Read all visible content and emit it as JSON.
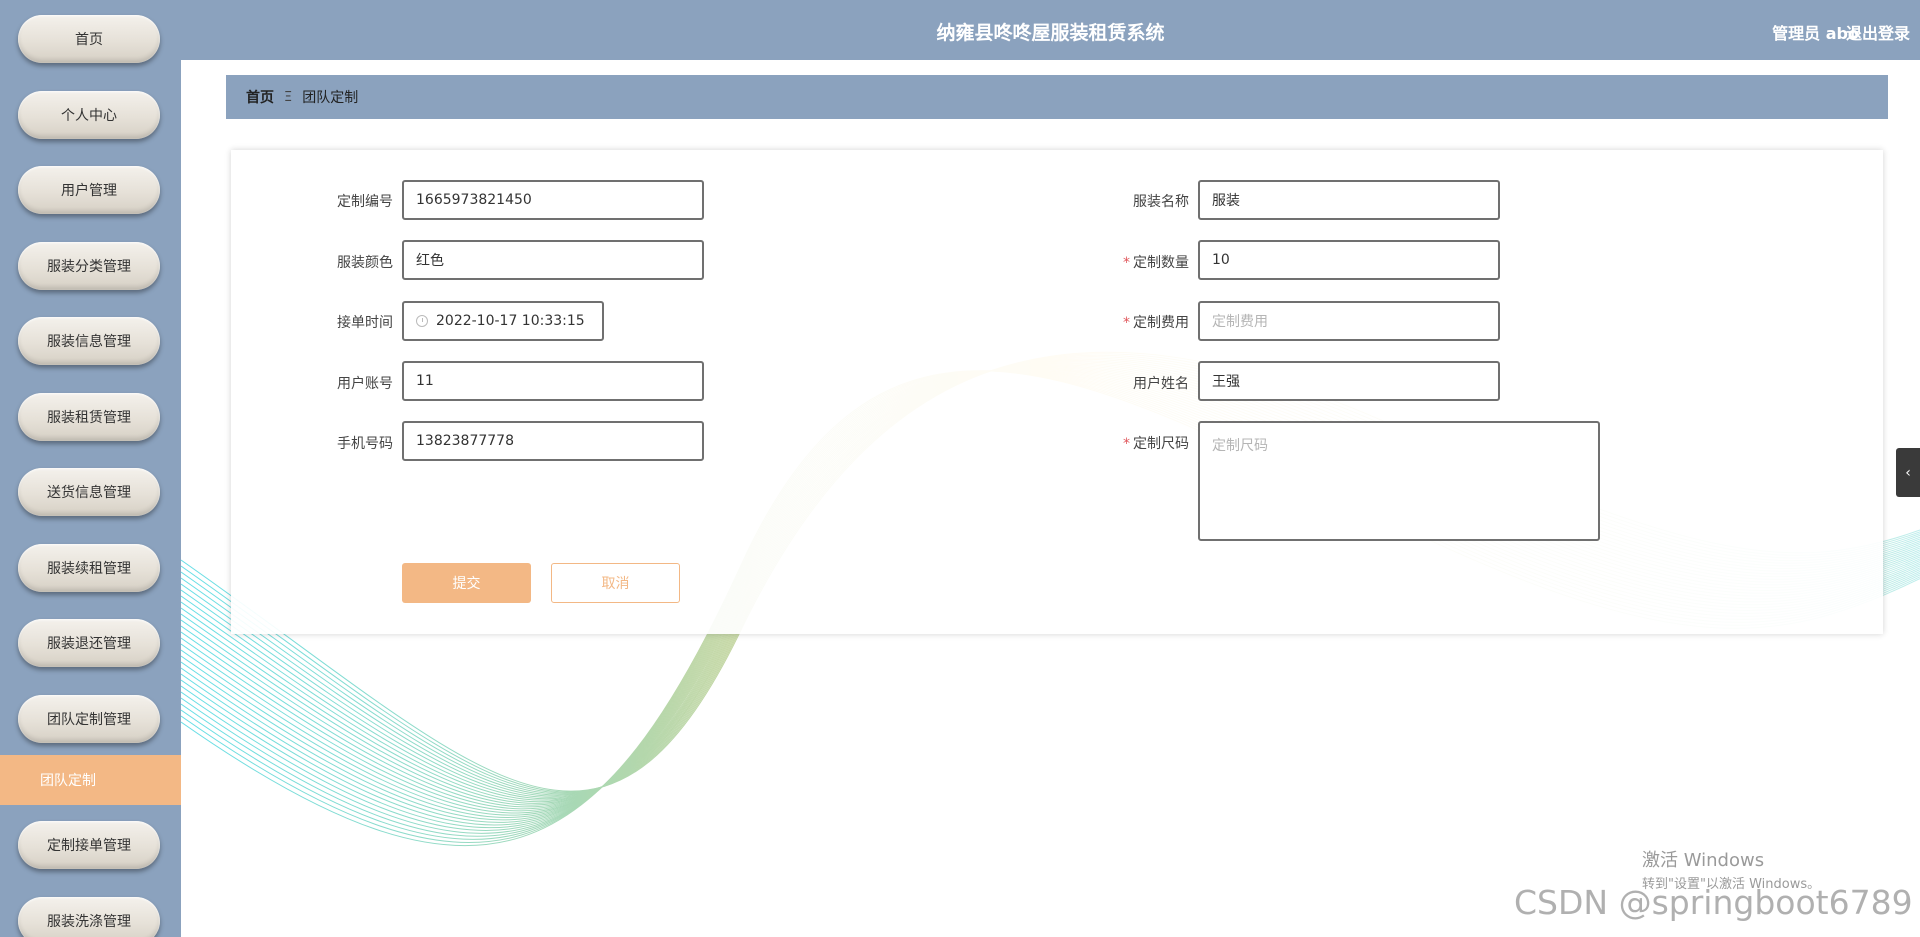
{
  "header": {
    "title": "纳雍县咚咚屋服装租赁系统",
    "user": "管理员 abo",
    "logout": "退出登录"
  },
  "sidebar": {
    "items": [
      {
        "label": "首页"
      },
      {
        "label": "个人中心"
      },
      {
        "label": "用户管理"
      },
      {
        "label": "服装分类管理"
      },
      {
        "label": "服装信息管理"
      },
      {
        "label": "服装租赁管理"
      },
      {
        "label": "送货信息管理"
      },
      {
        "label": "服装续租管理"
      },
      {
        "label": "服装退还管理"
      },
      {
        "label": "团队定制管理"
      },
      {
        "label": "定制接单管理"
      },
      {
        "label": "服装洗涤管理"
      }
    ],
    "active_sub": "团队定制"
  },
  "breadcrumb": {
    "home": "首页",
    "separator": "Ξ",
    "current": "团队定制"
  },
  "form": {
    "order_no": {
      "label": "定制编号",
      "value": "1665973821450"
    },
    "garment_name": {
      "label": "服装名称",
      "value": "服装"
    },
    "color": {
      "label": "服装颜色",
      "value": "红色"
    },
    "quantity": {
      "label": "定制数量",
      "value": "10",
      "required": "*"
    },
    "accept_time": {
      "label": "接单时间",
      "value": "2022-10-17 10:33:15"
    },
    "fee": {
      "label": "定制费用",
      "placeholder": "定制费用",
      "required": "*"
    },
    "account": {
      "label": "用户账号",
      "value": "11"
    },
    "username": {
      "label": "用户姓名",
      "value": "王强"
    },
    "phone": {
      "label": "手机号码",
      "value": "13823877778"
    },
    "size": {
      "label": "定制尺码",
      "placeholder": "定制尺码",
      "required": "*"
    },
    "submit": "提交",
    "cancel": "取消"
  },
  "collapse_icon": "‹",
  "watermark": {
    "windows_title": "激活 Windows",
    "windows_sub": "转到\"设置\"以激活 Windows。",
    "csdn": "CSDN @springboot6789"
  },
  "colors": {
    "primary": "#8ba2be",
    "accent": "#f3b885",
    "required": "#e0565b"
  }
}
